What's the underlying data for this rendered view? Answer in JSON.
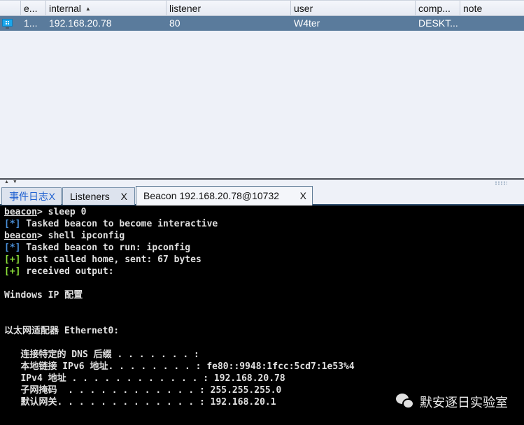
{
  "table": {
    "columns": [
      {
        "label": "",
        "key": "icon"
      },
      {
        "label": "e...",
        "key": "external"
      },
      {
        "label": "internal",
        "key": "internal",
        "sort": "ascending"
      },
      {
        "label": "listener",
        "key": "listener"
      },
      {
        "label": "user",
        "key": "user"
      },
      {
        "label": "comp...",
        "key": "computer"
      },
      {
        "label": "note",
        "key": "note"
      }
    ],
    "sort_indicator": "▲",
    "rows": [
      {
        "icon": "windows-monitor-icon",
        "external": "1...",
        "internal": "192.168.20.78",
        "listener": "80",
        "user": "W4ter",
        "computer": "DESKT...",
        "note": "",
        "selected": true
      }
    ]
  },
  "splitter": {
    "arrows": "▲▼"
  },
  "tabs": [
    {
      "label": "事件日志",
      "close": "X"
    },
    {
      "label": "Listeners",
      "close": "X"
    },
    {
      "label": "Beacon 192.168.20.78@10732",
      "close": "X",
      "active": true
    }
  ],
  "console": {
    "lines": [
      {
        "prompt": "beacon",
        "text": "> sleep 0"
      },
      {
        "tag": "[*]",
        "tag_color": "blue",
        "text": " Tasked beacon to become interactive"
      },
      {
        "prompt": "beacon",
        "text": "> shell ipconfig"
      },
      {
        "tag": "[*]",
        "tag_color": "blue",
        "text": " Tasked beacon to run: ipconfig"
      },
      {
        "tag": "[+]",
        "tag_color": "green",
        "text": " host called home, sent: 67 bytes"
      },
      {
        "tag": "[+]",
        "tag_color": "green",
        "text": " received output:"
      },
      {
        "text": ""
      },
      {
        "text": "Windows IP 配置"
      },
      {
        "text": ""
      },
      {
        "text": ""
      },
      {
        "text": "以太网适配器 Ethernet0:"
      },
      {
        "text": ""
      },
      {
        "text": "   连接特定的 DNS 后缀 . . . . . . . :"
      },
      {
        "text": "   本地链接 IPv6 地址. . . . . . . . : fe80::9948:1fcc:5cd7:1e53%4"
      },
      {
        "text": "   IPv4 地址 . . . . . . . . . . . . : 192.168.20.78"
      },
      {
        "text": "   子网掩码  . . . . . . . . . . . . : 255.255.255.0"
      },
      {
        "text": "   默认网关. . . . . . . . . . . . . : 192.168.20.1"
      }
    ]
  },
  "watermark": {
    "icon": "wechat-icon",
    "text": "默安逐日实验室"
  },
  "colors": {
    "selected_row": "#5a7b9c",
    "tag_blue": "#4a8fd8",
    "tag_green": "#8ce23a",
    "tab_blue_text": "#1d5fd0"
  }
}
